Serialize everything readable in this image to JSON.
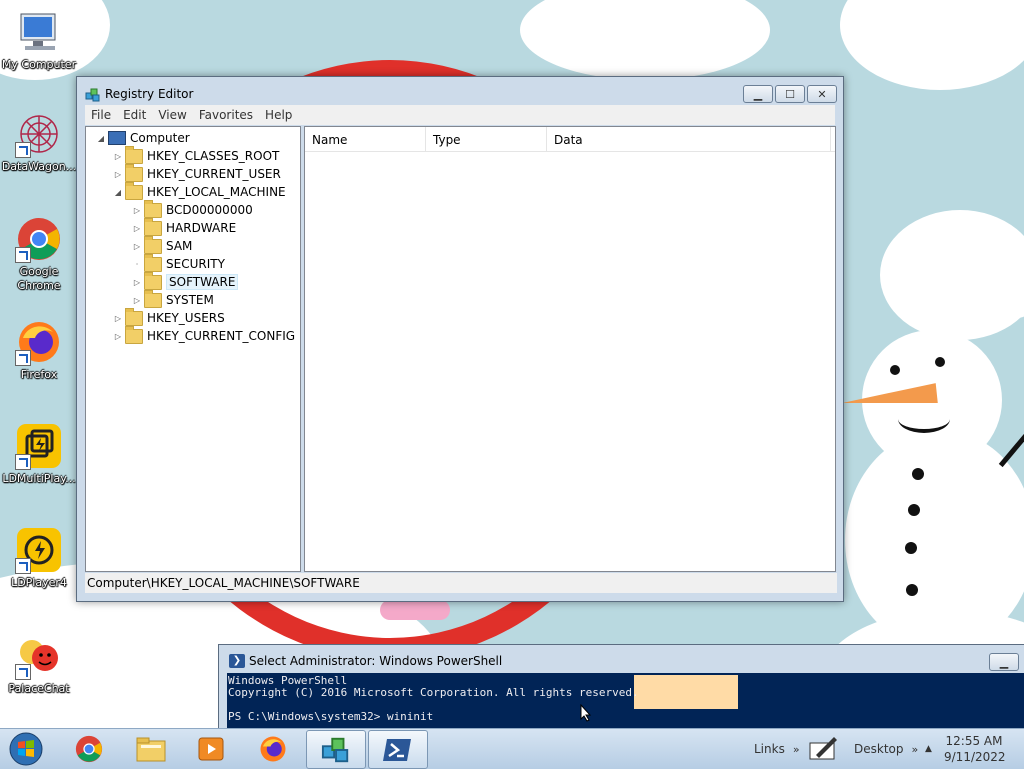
{
  "desktop": {
    "icons": [
      {
        "label": "My Computer",
        "icon": "computer-icon"
      },
      {
        "label": "DataWagon...",
        "icon": "datawagon-icon"
      },
      {
        "label": "Google Chrome",
        "icon": "chrome-icon"
      },
      {
        "label": "Firefox",
        "icon": "firefox-icon"
      },
      {
        "label": "LDMultiPlay...",
        "icon": "ldmultiplayer-icon"
      },
      {
        "label": "LDPlayer4",
        "icon": "ldplayer-icon"
      },
      {
        "label": "PalaceChat",
        "icon": "palacechat-icon"
      }
    ]
  },
  "regedit": {
    "title": "Registry Editor",
    "menu": [
      "File",
      "Edit",
      "View",
      "Favorites",
      "Help"
    ],
    "tree": {
      "root": "Computer",
      "hives": [
        {
          "label": "HKEY_CLASSES_ROOT",
          "expanded": false
        },
        {
          "label": "HKEY_CURRENT_USER",
          "expanded": false
        },
        {
          "label": "HKEY_LOCAL_MACHINE",
          "expanded": true,
          "children": [
            {
              "label": "BCD00000000"
            },
            {
              "label": "HARDWARE"
            },
            {
              "label": "SAM"
            },
            {
              "label": "SECURITY"
            },
            {
              "label": "SOFTWARE",
              "selected": true
            },
            {
              "label": "SYSTEM"
            }
          ]
        },
        {
          "label": "HKEY_USERS",
          "expanded": false
        },
        {
          "label": "HKEY_CURRENT_CONFIG",
          "expanded": false
        }
      ]
    },
    "columns": [
      "Name",
      "Type",
      "Data"
    ],
    "status": "Computer\\HKEY_LOCAL_MACHINE\\SOFTWARE"
  },
  "powershell": {
    "title": "Select Administrator: Windows PowerShell",
    "lines": [
      "Windows PowerShell",
      "Copyright (C) 2016 Microsoft Corporation. All rights reserved.",
      "",
      "PS C:\\Windows\\system32> wininit"
    ]
  },
  "taskbar": {
    "pinned": [
      "chrome-icon",
      "file-explorer-icon",
      "media-player-icon",
      "firefox-icon",
      "regedit-icon",
      "powershell-icon"
    ],
    "toolbars": {
      "links": "Links",
      "desktop": "Desktop"
    },
    "clock": {
      "time": "12:55 AM",
      "date": "9/11/2022"
    }
  },
  "colors": {
    "desktop_bg": "#b9d9e0",
    "ps_bg": "#012456",
    "selection_hl": "#ffdba6"
  }
}
